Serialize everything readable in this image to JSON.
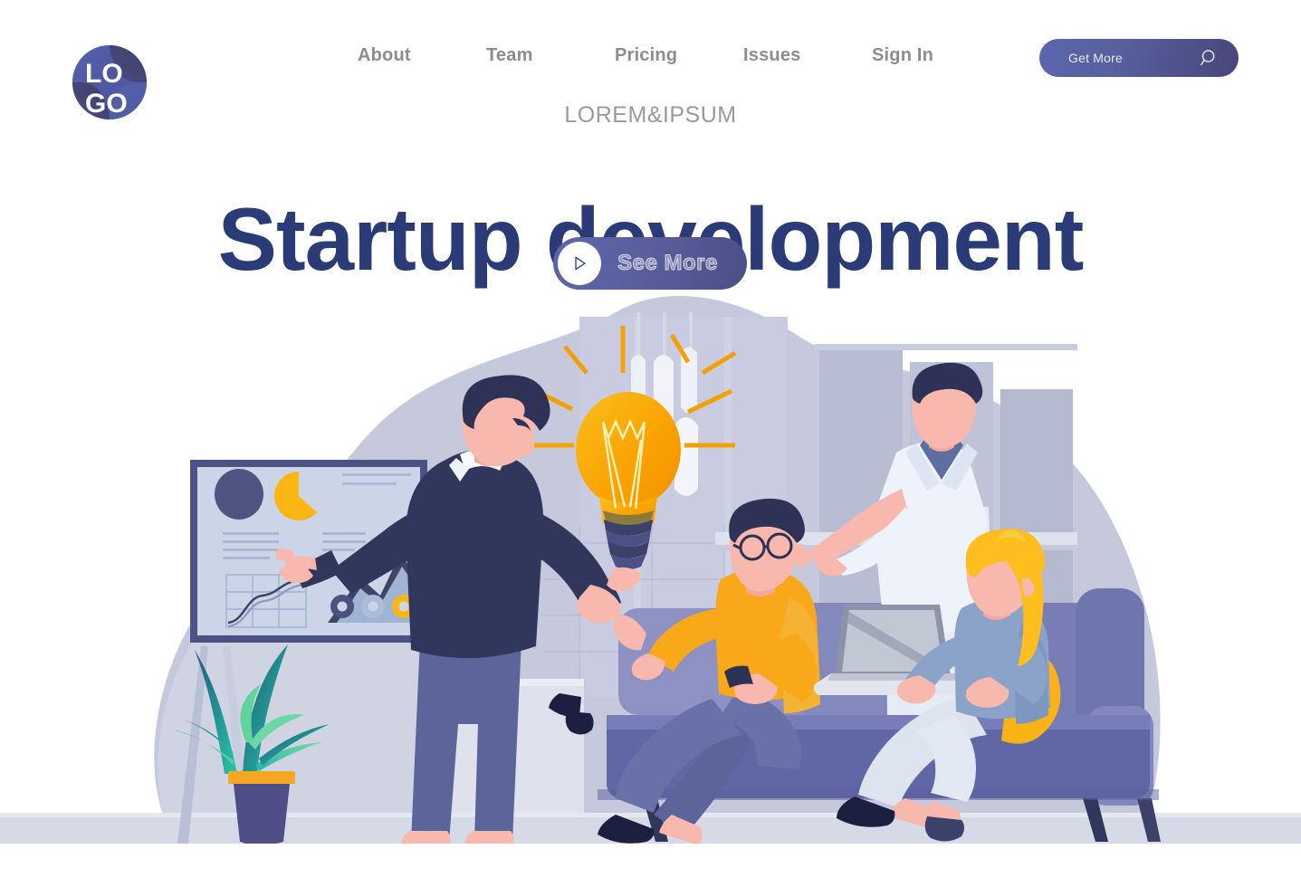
{
  "header": {
    "logo": {
      "name": "logo-mark",
      "text_top": "LO",
      "text_bottom": "GO"
    },
    "nav_items": [
      {
        "label": "About"
      },
      {
        "label": "Team"
      },
      {
        "label": "Pricing"
      },
      {
        "label": "Issues"
      },
      {
        "label": "Sign In"
      }
    ],
    "cta": {
      "label": "Get More",
      "icon": "search-icon"
    }
  },
  "hero": {
    "kicker": "LOREM&IPSUM",
    "title": "Startup development",
    "button": {
      "label": "See More",
      "icon": "play-icon"
    }
  },
  "colors": {
    "brand_navy": "#2b3b77",
    "nav_gray": "#8d8d8d",
    "kicker_gray": "#9a9a9a",
    "button_gradient_start": "#5b66ad",
    "button_gradient_end": "#47477a",
    "accent_orange": "#f9a81a",
    "accent_yellow": "#fcb614",
    "bg_blob": "#c3c6d9",
    "bg_blob_light": "#cfd2e2",
    "sofa": "#7b80bb",
    "sofa_dark": "#5e64a6",
    "skin": "#f9b8ae",
    "hair_dark": "#2e3257",
    "shirt_orange": "#f9a81a",
    "jeans_blue": "#5c6499",
    "plant_teal": "#1aa7a0",
    "plant_dark": "#1d5f78",
    "pot": "#4e4f87",
    "white_shirt": "#dfe6f2",
    "floor": "#d7dae6"
  },
  "illustration": {
    "name": "startup-team-illustration",
    "scene_elements": [
      "presentation-board",
      "pie-chart",
      "line-chart",
      "mountain-chart",
      "donut-indicators",
      "light-bulb",
      "pendant-lamps",
      "potted-plant",
      "sofa",
      "laptop",
      "presenter-man",
      "seated-man-glasses",
      "standing-man",
      "seated-woman"
    ],
    "board": {
      "pie_label": "pie-chart-orange",
      "donuts": [
        "donut-navy",
        "donut-lightblue",
        "donut-orange"
      ]
    }
  }
}
